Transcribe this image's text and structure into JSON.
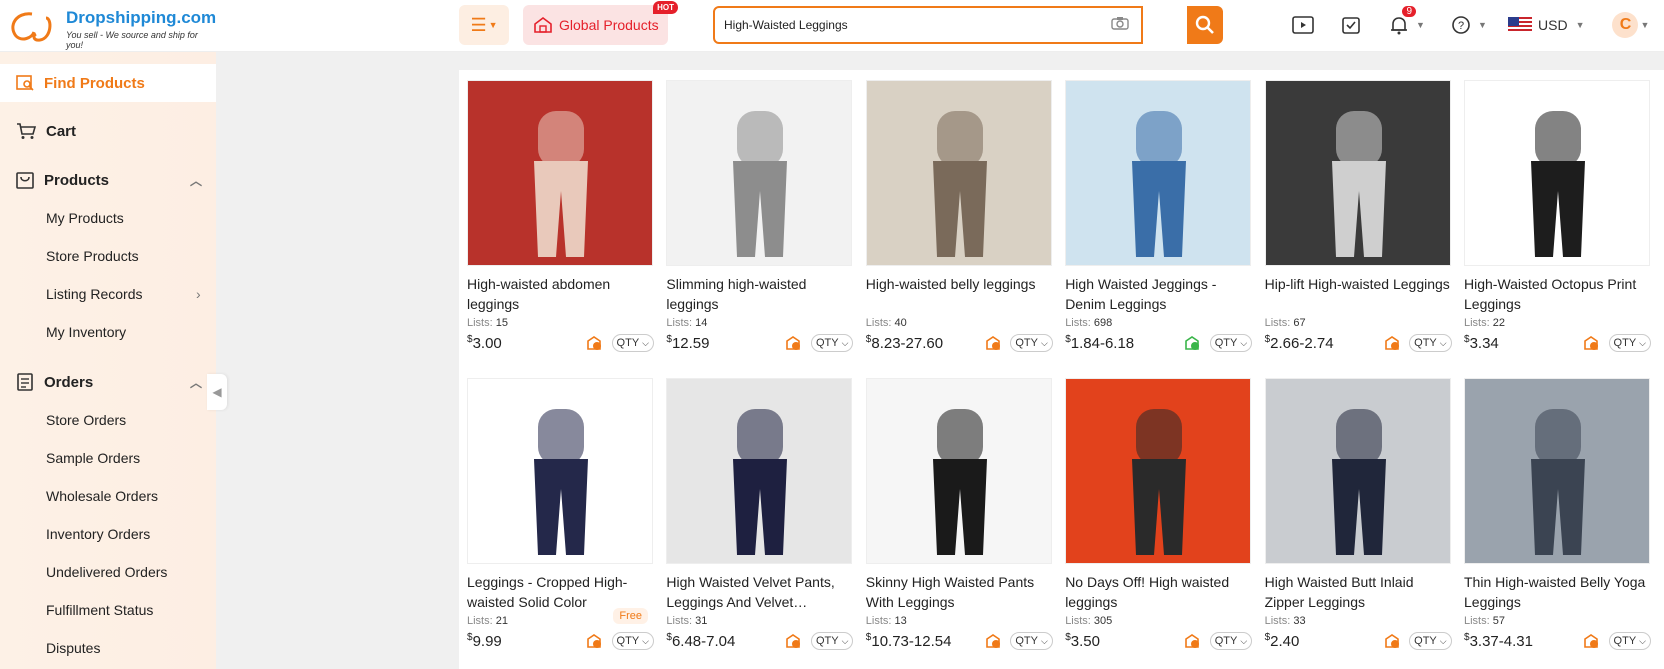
{
  "header": {
    "brand": "Dropshipping.com",
    "tagline": "You sell - We source and ship for you!",
    "global_products": "Global Products",
    "hot": "HOT",
    "search_value": "High-Waisted Leggings",
    "notification_count": "9",
    "currency": "USD",
    "avatar_letter": "C"
  },
  "sidebar": {
    "find_products": "Find Products",
    "cart": "Cart",
    "products": "Products",
    "my_products": "My Products",
    "store_products": "Store Products",
    "listing_records": "Listing Records",
    "my_inventory": "My Inventory",
    "orders": "Orders",
    "store_orders": "Store Orders",
    "sample_orders": "Sample Orders",
    "wholesale_orders": "Wholesale Orders",
    "inventory_orders": "Inventory Orders",
    "undelivered_orders": "Undelivered Orders",
    "fulfillment_status": "Fulfillment Status",
    "disputes": "Disputes"
  },
  "labels": {
    "lists": "Lists: ",
    "qty": "QTY",
    "free": "Free",
    "currency_symbol": "$"
  },
  "products": [
    {
      "title": "High-waisted abdomen leggings",
      "lists": "15",
      "price": "3.00",
      "ship": "orange"
    },
    {
      "title": "Slimming high-waisted leggings",
      "lists": "14",
      "price": "12.59",
      "ship": "orange"
    },
    {
      "title": "High-waisted belly leggings",
      "lists": "40",
      "price": "8.23-27.60",
      "ship": "orange"
    },
    {
      "title": "High Waisted Jeggings - Denim Leggings",
      "lists": "698",
      "price": "1.84-6.18",
      "ship": "green"
    },
    {
      "title": "Hip-lift High-waisted Leggings",
      "lists": "67",
      "price": "2.66-2.74",
      "ship": "orange"
    },
    {
      "title": "High-Waisted Octopus Print Leggings",
      "lists": "22",
      "price": "3.34",
      "ship": "orange"
    },
    {
      "title": "Leggings - Cropped High-waisted Solid Color",
      "lists": "21",
      "price": "9.99",
      "ship": "orange",
      "free": true
    },
    {
      "title": "High Waisted Velvet Pants, Leggings And Velvet…",
      "lists": "31",
      "price": "6.48-7.04",
      "ship": "orange"
    },
    {
      "title": "Skinny High Waisted Pants With Leggings",
      "lists": "13",
      "price": "10.73-12.54",
      "ship": "orange"
    },
    {
      "title": "No Days Off! High waisted leggings",
      "lists": "305",
      "price": "3.50",
      "ship": "orange"
    },
    {
      "title": "High Waisted Butt Inlaid Zipper Leggings",
      "lists": "33",
      "price": "2.40",
      "ship": "orange"
    },
    {
      "title": "Thin High-waisted Belly Yoga Leggings",
      "lists": "57",
      "price": "3.37-4.31",
      "ship": "orange"
    }
  ],
  "colors": {
    "accent": "#f07a18",
    "ship_orange": "#f07a18",
    "ship_green": "#3ab54a"
  }
}
